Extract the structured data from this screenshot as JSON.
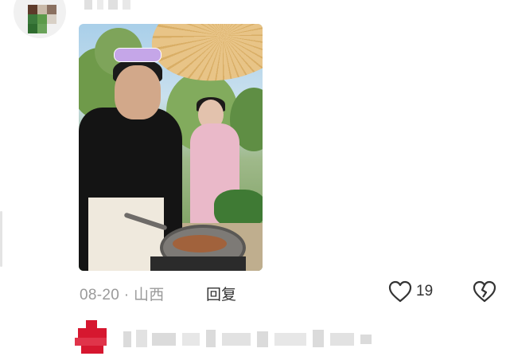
{
  "comment": {
    "date": "08-20",
    "separator": "·",
    "location": "山西",
    "reply_label": "回复",
    "like_count": "19"
  },
  "icons": {
    "like": "heart-outline-icon",
    "dislike": "broken-heart-icon"
  },
  "colors": {
    "meta_gray": "#9a9a9a",
    "text_dark": "#333333",
    "avatar_red": "#d6172f"
  }
}
